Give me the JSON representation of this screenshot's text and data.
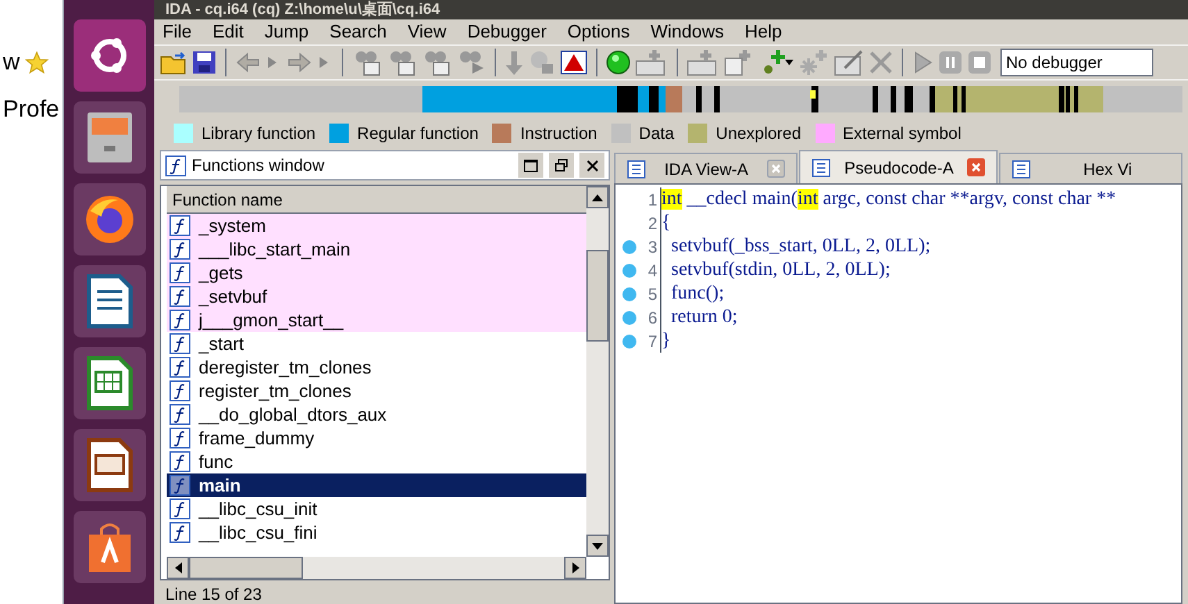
{
  "browser_strip": {
    "texts": [
      "w",
      "Profe"
    ]
  },
  "window": {
    "title": "IDA - cq.i64 (cq) Z:\\home\\u\\桌面\\cq.i64"
  },
  "menu": [
    "File",
    "Edit",
    "Jump",
    "Search",
    "View",
    "Debugger",
    "Options",
    "Windows",
    "Help"
  ],
  "toolbar": {
    "debugger_select": "No debugger"
  },
  "legend": [
    {
      "label": "Library function",
      "color": "#aaffff"
    },
    {
      "label": "Regular function",
      "color": "#00a0e0"
    },
    {
      "label": "Instruction",
      "color": "#b87a5a"
    },
    {
      "label": "Data",
      "color": "#c0c0c0"
    },
    {
      "label": "Unexplored",
      "color": "#b4b46e"
    },
    {
      "label": "External symbol",
      "color": "#ffaaff"
    }
  ],
  "functions_window": {
    "title": "Functions window",
    "column": "Function name",
    "rows": [
      {
        "name": "_system",
        "kind": "external",
        "selected": false
      },
      {
        "name": "___libc_start_main",
        "kind": "external",
        "selected": false
      },
      {
        "name": "_gets",
        "kind": "external",
        "selected": false
      },
      {
        "name": "_setvbuf",
        "kind": "external",
        "selected": false
      },
      {
        "name": "j___gmon_start__",
        "kind": "external",
        "selected": false
      },
      {
        "name": "_start",
        "kind": "regular",
        "selected": false
      },
      {
        "name": "deregister_tm_clones",
        "kind": "regular",
        "selected": false
      },
      {
        "name": "register_tm_clones",
        "kind": "regular",
        "selected": false
      },
      {
        "name": "__do_global_dtors_aux",
        "kind": "regular",
        "selected": false
      },
      {
        "name": "frame_dummy",
        "kind": "regular",
        "selected": false
      },
      {
        "name": "func",
        "kind": "regular",
        "selected": false
      },
      {
        "name": "main",
        "kind": "regular",
        "selected": true
      },
      {
        "name": "__libc_csu_init",
        "kind": "regular",
        "selected": false
      },
      {
        "name": "__libc_csu_fini",
        "kind": "regular",
        "selected": false
      }
    ],
    "status": "Line 15 of 23"
  },
  "tabs": [
    {
      "label": "IDA View-A",
      "selected": false
    },
    {
      "label": "Pseudocode-A",
      "selected": true
    },
    {
      "label": "Hex Vi",
      "selected": false
    }
  ],
  "code": [
    {
      "number": "1",
      "marked": false,
      "tokens": [
        {
          "text": "int",
          "highlighted": true
        },
        {
          "text": " __cdecl main(",
          "highlighted": false
        },
        {
          "text": "int",
          "highlighted": true
        },
        {
          "text": " argc, const char **argv, const char **",
          "highlighted": false
        }
      ]
    },
    {
      "number": "2",
      "marked": false,
      "tokens": [
        {
          "text": "{",
          "highlighted": false
        }
      ]
    },
    {
      "number": "3",
      "marked": true,
      "tokens": [
        {
          "text": "  setvbuf(_bss_start, 0LL, 2, 0LL);",
          "highlighted": false
        }
      ]
    },
    {
      "number": "4",
      "marked": true,
      "tokens": [
        {
          "text": "  setvbuf(stdin, 0LL, 2, 0LL);",
          "highlighted": false
        }
      ]
    },
    {
      "number": "5",
      "marked": true,
      "tokens": [
        {
          "text": "  func();",
          "highlighted": false
        }
      ]
    },
    {
      "number": "6",
      "marked": true,
      "tokens": [
        {
          "text": "  return 0;",
          "highlighted": false
        }
      ]
    },
    {
      "number": "7",
      "marked": true,
      "tokens": [
        {
          "text": "}",
          "highlighted": false
        }
      ]
    }
  ]
}
